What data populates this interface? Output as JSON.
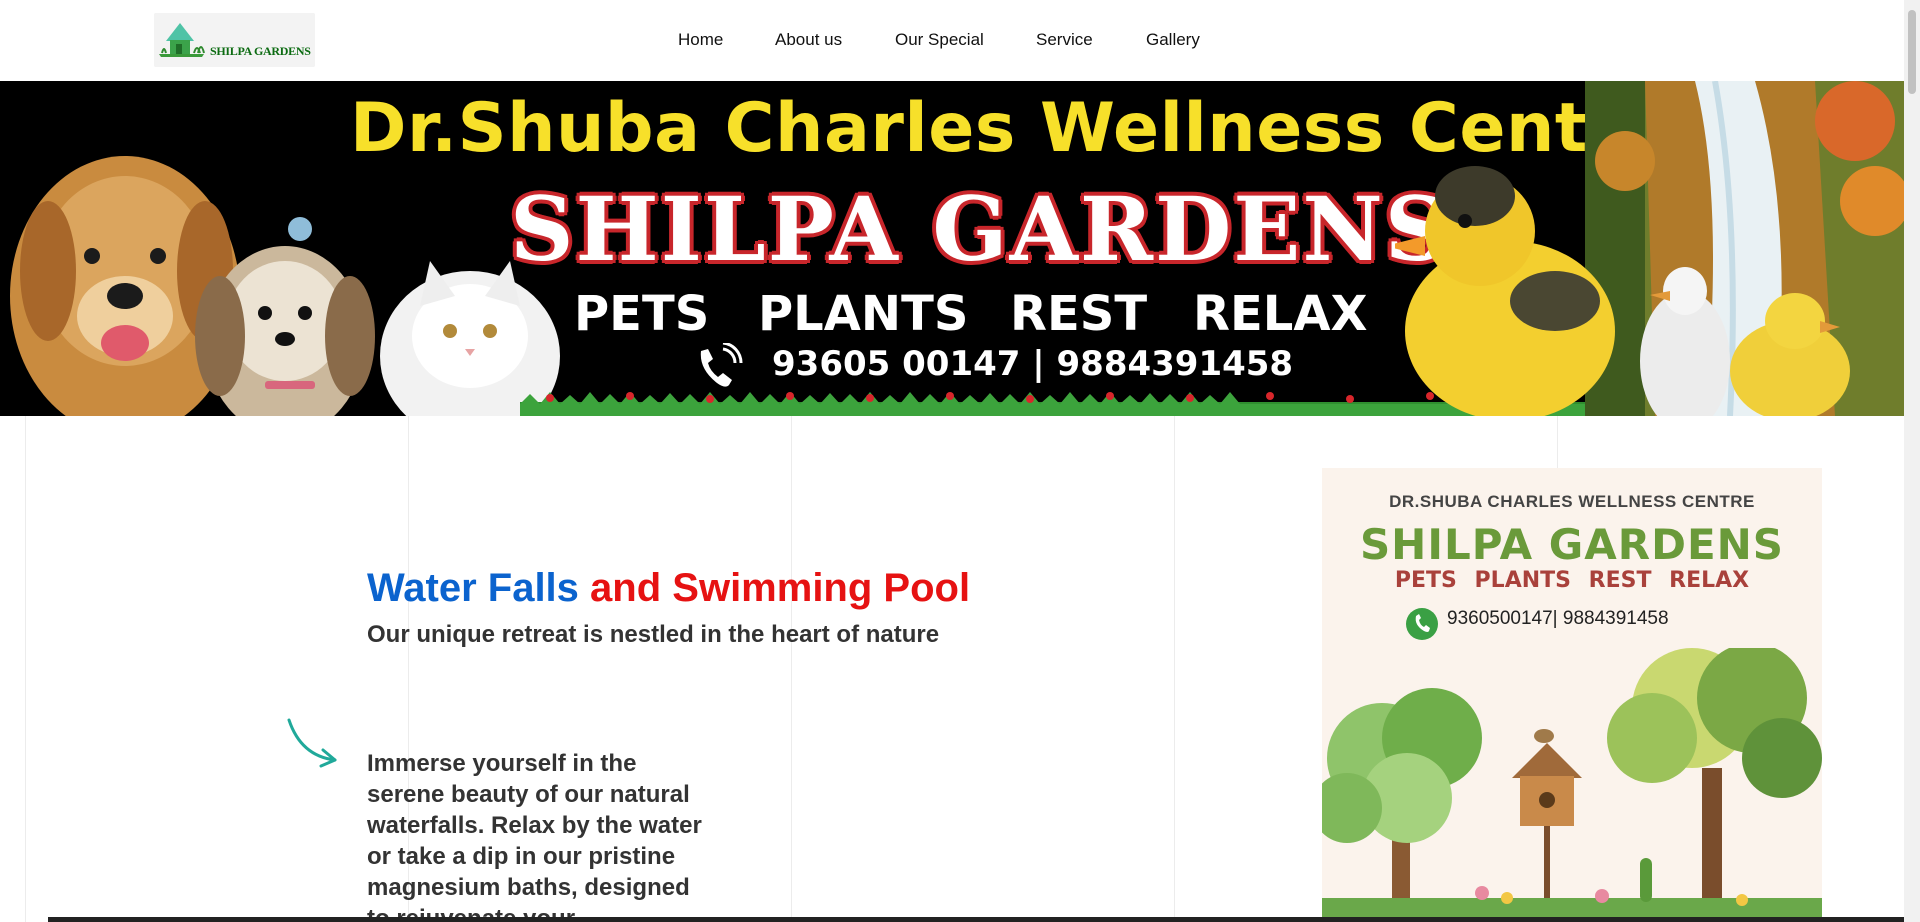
{
  "header": {
    "logo_text": "SHILPA GARDENS",
    "nav": [
      {
        "label": "Home"
      },
      {
        "label": "About us"
      },
      {
        "label": "Our Special"
      },
      {
        "label": "Service"
      },
      {
        "label": "Gallery"
      }
    ]
  },
  "banner": {
    "title": "Dr.Shuba Charles Wellness Center",
    "brand": "SHILPA GARDENS",
    "words": [
      "PETS",
      "PLANTS",
      "REST",
      "RELAX"
    ],
    "phone": "93605 00147 | 9884391458"
  },
  "main": {
    "heading_part1": "Water Falls",
    "heading_part2": "and Swimming Pool",
    "subheading": "Our unique retreat is nestled in the heart of nature",
    "paragraph": "Immerse yourself in the serene beauty of our natural waterfalls. Relax by the water or take a dip in our pristine magnesium baths, designed to rejuvenate your"
  },
  "poster": {
    "top_line": "DR.SHUBA CHARLES WELLNESS CENTRE",
    "brand": "SHILPA GARDENS",
    "words": "PETS PLANTS REST RELAX",
    "phone": "9360500147| 9884391458"
  },
  "colors": {
    "heading_blue": "#0b63ce",
    "heading_red": "#e61212",
    "banner_yellow": "#f7e02a",
    "poster_green": "#6a9a3a",
    "poster_red": "#a9413b"
  }
}
